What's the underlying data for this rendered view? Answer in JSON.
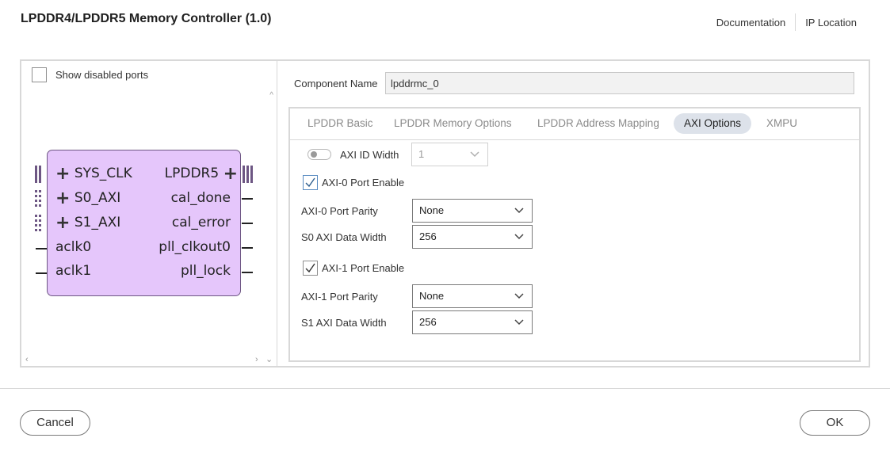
{
  "window": {
    "title": "LPDDR4/LPDDR5  Memory Controller (1.0)"
  },
  "header": {
    "documentation": "Documentation",
    "ip_location": "IP Location"
  },
  "left_pane": {
    "show_disabled_ports_label": "Show disabled ports",
    "show_disabled_ports_checked": false,
    "block": {
      "left_ports": [
        "SYS_CLK",
        "S0_AXI",
        "S1_AXI",
        "aclk0",
        "aclk1"
      ],
      "right_ports": [
        "LPDDR5",
        "cal_done",
        "cal_error",
        "pll_clkout0",
        "pll_lock"
      ],
      "plus_symbol": "+"
    },
    "scroll_up": "^",
    "scroll_left": "‹",
    "scroll_right": "›",
    "scroll_down": "⌄"
  },
  "component": {
    "label": "Component Name",
    "value": "lpddrmc_0"
  },
  "tabs": {
    "items": [
      "LPDDR Basic",
      "LPDDR Memory Options",
      "LPDDR Address Mapping",
      "AXI Options",
      "XMPU"
    ],
    "active": "AXI Options"
  },
  "axi_options": {
    "axi_id_width": {
      "label": "AXI ID Width",
      "value": "1",
      "enabled": false
    },
    "axi0_port_enable": {
      "label": "AXI-0 Port Enable",
      "checked": true
    },
    "axi0_port_parity": {
      "label": "AXI-0 Port Parity",
      "value": "None"
    },
    "s0_axi_data_width": {
      "label": "S0 AXI Data Width",
      "value": "256"
    },
    "axi1_port_enable": {
      "label": "AXI-1 Port Enable",
      "checked": true
    },
    "axi1_port_parity": {
      "label": "AXI-1 Port Parity",
      "value": "None"
    },
    "s1_axi_data_width": {
      "label": "S1 AXI Data Width",
      "value": "256"
    }
  },
  "footer": {
    "cancel": "Cancel",
    "ok": "OK"
  },
  "colors": {
    "block_fill": "#e5c6fb",
    "block_border": "#6d5683",
    "active_tab": "#dde2ea",
    "checkbox_border": "#5a8cc2"
  }
}
